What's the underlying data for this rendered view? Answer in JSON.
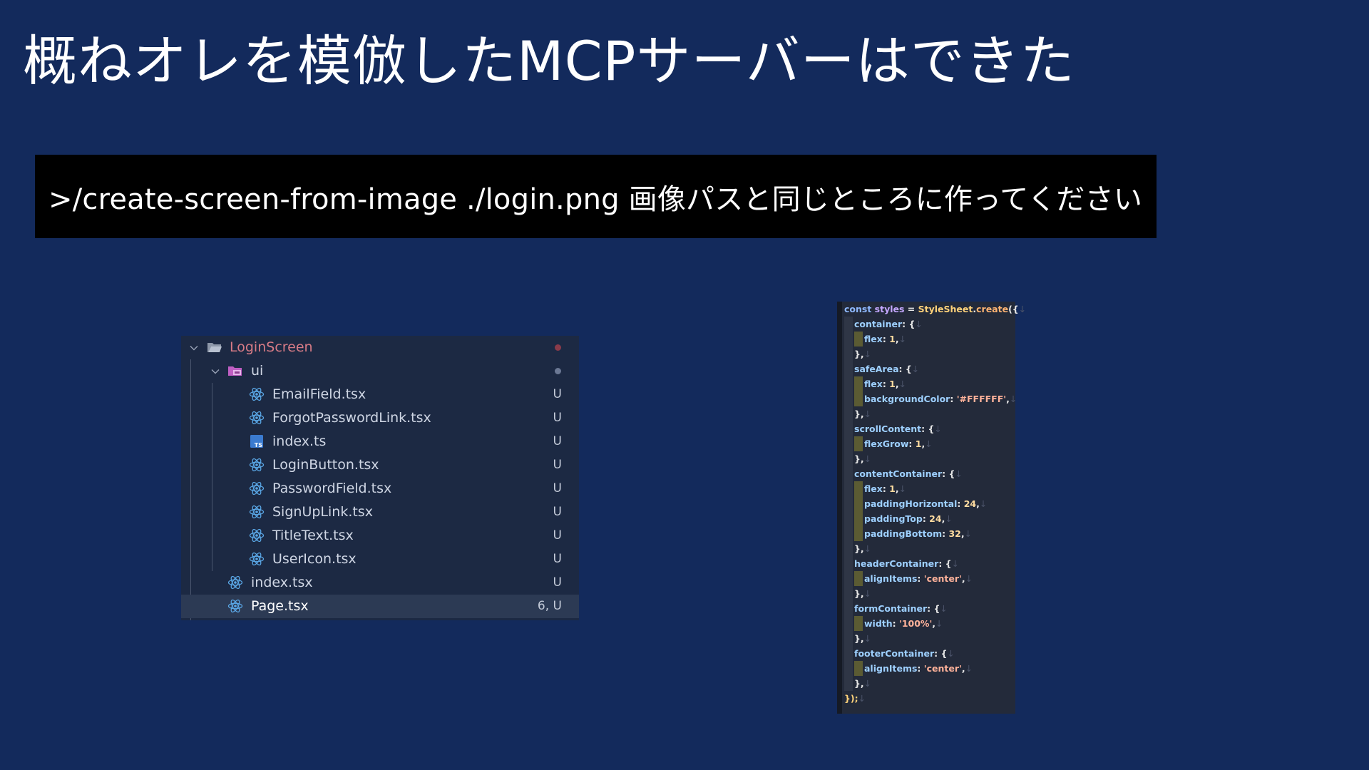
{
  "slide": {
    "title": "概ねオレを模倣したMCPサーバーはできた",
    "prompt": ">/create-screen-from-image ./login.png 画像パスと同じところに作ってください"
  },
  "explorer": {
    "root_folder": "LoginScreen",
    "subfolder": "ui",
    "ui_files": [
      {
        "name": "EmailField.tsx",
        "status": "U",
        "icon": "react-icon"
      },
      {
        "name": "ForgotPasswordLink.tsx",
        "status": "U",
        "icon": "react-icon"
      },
      {
        "name": "index.ts",
        "status": "U",
        "icon": "typescript-icon"
      },
      {
        "name": "LoginButton.tsx",
        "status": "U",
        "icon": "react-icon"
      },
      {
        "name": "PasswordField.tsx",
        "status": "U",
        "icon": "react-icon"
      },
      {
        "name": "SignUpLink.tsx",
        "status": "U",
        "icon": "react-icon"
      },
      {
        "name": "TitleText.tsx",
        "status": "U",
        "icon": "react-icon"
      },
      {
        "name": "UserIcon.tsx",
        "status": "U",
        "icon": "react-icon"
      }
    ],
    "root_files": [
      {
        "name": "index.tsx",
        "status": "U",
        "icon": "react-icon"
      },
      {
        "name": "Page.tsx",
        "status": "6, U",
        "icon": "react-icon",
        "selected": true
      }
    ],
    "colors": {
      "root_folder_text": "#d77b86",
      "modified_dot_root": "#8a3b4a",
      "modified_dot_ui": "#6b7894",
      "react_icon": "#5aa7e6"
    }
  },
  "code": {
    "lines": [
      {
        "indent": 0,
        "tokens": [
          [
            "kw",
            "const "
          ],
          [
            "var",
            "styles"
          ],
          [
            "pun",
            " = "
          ],
          [
            "cls",
            "StyleSheet"
          ],
          [
            "pun",
            "."
          ],
          [
            "fn",
            "create"
          ],
          [
            "pun",
            "({"
          ],
          [
            "ret",
            "↓"
          ]
        ]
      },
      {
        "indent": 1,
        "tokens": [
          [
            "key",
            "container"
          ],
          [
            "pun",
            ": {"
          ],
          [
            "ret",
            "↓"
          ]
        ]
      },
      {
        "indent": 2,
        "tokens": [
          [
            "key",
            "flex"
          ],
          [
            "pun",
            ": "
          ],
          [
            "num",
            "1"
          ],
          [
            "pun",
            ","
          ],
          [
            "ret",
            "↓"
          ]
        ]
      },
      {
        "indent": 1,
        "tokens": [
          [
            "pun",
            "},"
          ],
          [
            "ret",
            "↓"
          ]
        ]
      },
      {
        "indent": 1,
        "tokens": [
          [
            "key",
            "safeArea"
          ],
          [
            "pun",
            ": {"
          ],
          [
            "ret",
            "↓"
          ]
        ]
      },
      {
        "indent": 2,
        "tokens": [
          [
            "key",
            "flex"
          ],
          [
            "pun",
            ": "
          ],
          [
            "num",
            "1"
          ],
          [
            "pun",
            ","
          ],
          [
            "ret",
            "↓"
          ]
        ]
      },
      {
        "indent": 2,
        "tokens": [
          [
            "key",
            "backgroundColor"
          ],
          [
            "pun",
            ": "
          ],
          [
            "str",
            "'#FFFFFF'"
          ],
          [
            "pun",
            ","
          ],
          [
            "ret",
            "↓"
          ]
        ]
      },
      {
        "indent": 1,
        "tokens": [
          [
            "pun",
            "},"
          ],
          [
            "ret",
            "↓"
          ]
        ]
      },
      {
        "indent": 1,
        "tokens": [
          [
            "key",
            "scrollContent"
          ],
          [
            "pun",
            ": {"
          ],
          [
            "ret",
            "↓"
          ]
        ]
      },
      {
        "indent": 2,
        "tokens": [
          [
            "key",
            "flexGrow"
          ],
          [
            "pun",
            ": "
          ],
          [
            "num",
            "1"
          ],
          [
            "pun",
            ","
          ],
          [
            "ret",
            "↓"
          ]
        ]
      },
      {
        "indent": 1,
        "tokens": [
          [
            "pun",
            "},"
          ],
          [
            "ret",
            "↓"
          ]
        ]
      },
      {
        "indent": 1,
        "tokens": [
          [
            "key",
            "contentContainer"
          ],
          [
            "pun",
            ": {"
          ],
          [
            "ret",
            "↓"
          ]
        ]
      },
      {
        "indent": 2,
        "tokens": [
          [
            "key",
            "flex"
          ],
          [
            "pun",
            ": "
          ],
          [
            "num",
            "1"
          ],
          [
            "pun",
            ","
          ],
          [
            "ret",
            "↓"
          ]
        ]
      },
      {
        "indent": 2,
        "tokens": [
          [
            "key",
            "paddingHorizontal"
          ],
          [
            "pun",
            ": "
          ],
          [
            "num",
            "24"
          ],
          [
            "pun",
            ","
          ],
          [
            "ret",
            "↓"
          ]
        ]
      },
      {
        "indent": 2,
        "tokens": [
          [
            "key",
            "paddingTop"
          ],
          [
            "pun",
            ": "
          ],
          [
            "num",
            "24"
          ],
          [
            "pun",
            ","
          ],
          [
            "ret",
            "↓"
          ]
        ]
      },
      {
        "indent": 2,
        "tokens": [
          [
            "key",
            "paddingBottom"
          ],
          [
            "pun",
            ": "
          ],
          [
            "num",
            "32"
          ],
          [
            "pun",
            ","
          ],
          [
            "ret",
            "↓"
          ]
        ]
      },
      {
        "indent": 1,
        "tokens": [
          [
            "pun",
            "},"
          ],
          [
            "ret",
            "↓"
          ]
        ]
      },
      {
        "indent": 1,
        "tokens": [
          [
            "key",
            "headerContainer"
          ],
          [
            "pun",
            ": {"
          ],
          [
            "ret",
            "↓"
          ]
        ]
      },
      {
        "indent": 2,
        "tokens": [
          [
            "key",
            "alignItems"
          ],
          [
            "pun",
            ": "
          ],
          [
            "str",
            "'center'"
          ],
          [
            "pun",
            ","
          ],
          [
            "ret",
            "↓"
          ]
        ]
      },
      {
        "indent": 1,
        "tokens": [
          [
            "pun",
            "},"
          ],
          [
            "ret",
            "↓"
          ]
        ]
      },
      {
        "indent": 1,
        "tokens": [
          [
            "key",
            "formContainer"
          ],
          [
            "pun",
            ": {"
          ],
          [
            "ret",
            "↓"
          ]
        ]
      },
      {
        "indent": 2,
        "tokens": [
          [
            "key",
            "width"
          ],
          [
            "pun",
            ": "
          ],
          [
            "str",
            "'100%'"
          ],
          [
            "pun",
            ","
          ],
          [
            "ret",
            "↓"
          ]
        ]
      },
      {
        "indent": 1,
        "tokens": [
          [
            "pun",
            "},"
          ],
          [
            "ret",
            "↓"
          ]
        ]
      },
      {
        "indent": 1,
        "tokens": [
          [
            "key",
            "footerContainer"
          ],
          [
            "pun",
            ": {"
          ],
          [
            "ret",
            "↓"
          ]
        ]
      },
      {
        "indent": 2,
        "tokens": [
          [
            "key",
            "alignItems"
          ],
          [
            "pun",
            ": "
          ],
          [
            "str",
            "'center'"
          ],
          [
            "pun",
            ","
          ],
          [
            "ret",
            "↓"
          ]
        ]
      },
      {
        "indent": 1,
        "tokens": [
          [
            "pun",
            "},"
          ],
          [
            "ret",
            "↓"
          ]
        ]
      },
      {
        "indent": 0,
        "tokens": [
          [
            "cls",
            "});"
          ],
          [
            "ret",
            "↓"
          ]
        ]
      }
    ]
  }
}
